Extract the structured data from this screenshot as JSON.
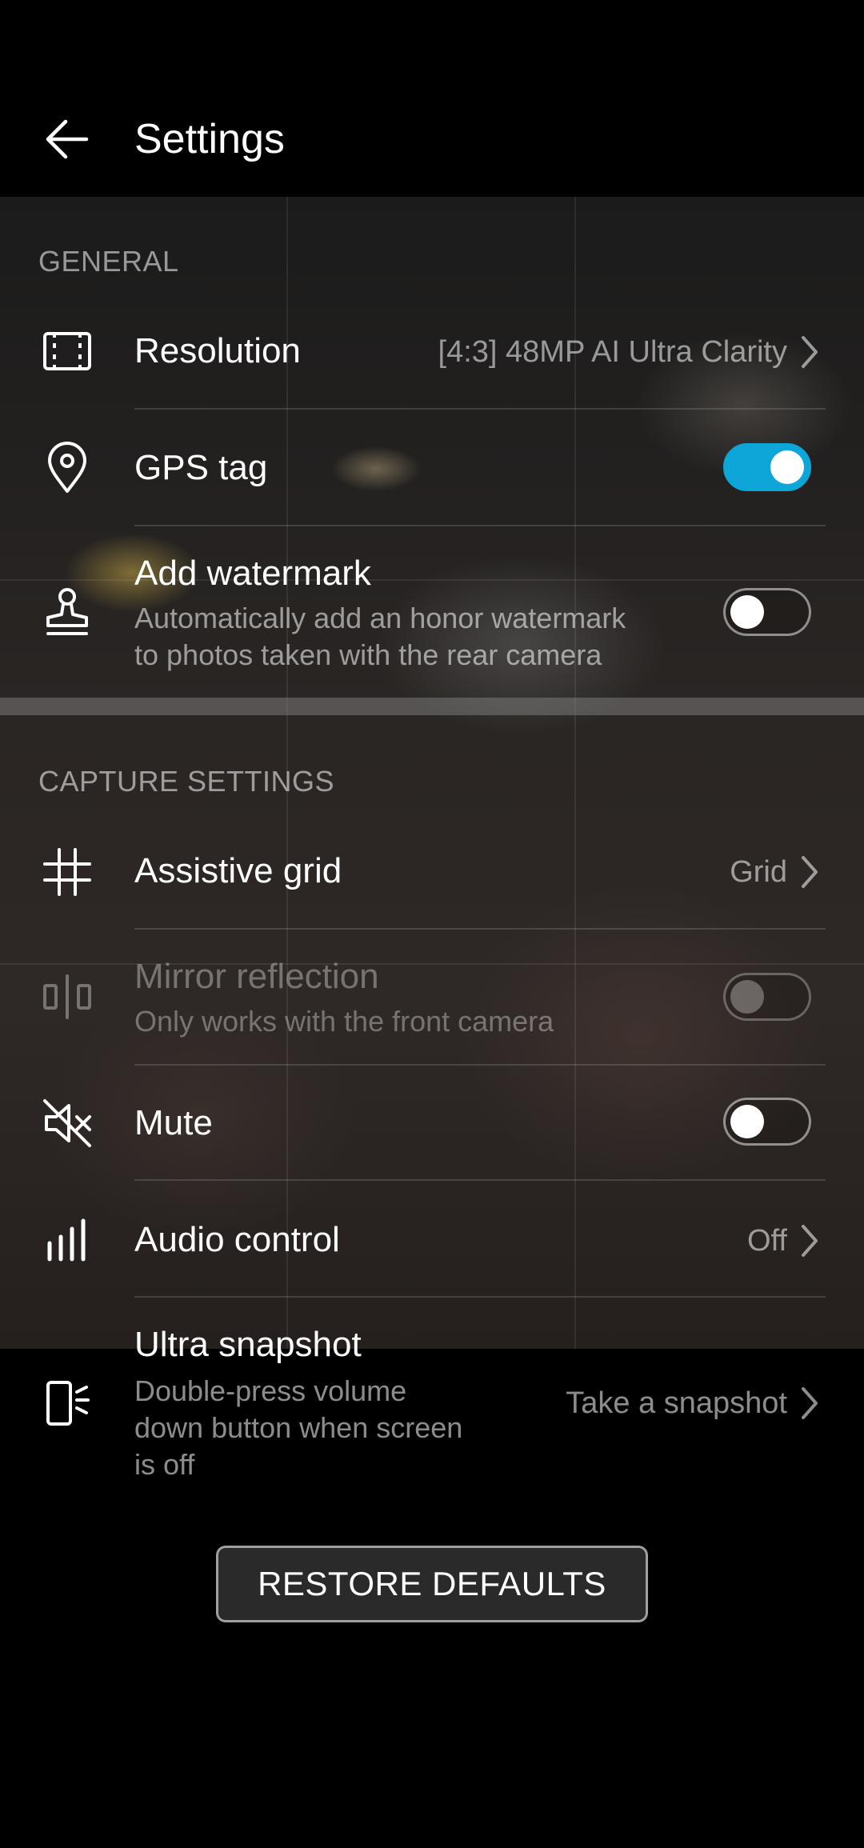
{
  "header": {
    "title": "Settings"
  },
  "general": {
    "label": "GENERAL",
    "resolution": {
      "title": "Resolution",
      "value": "[4:3] 48MP AI Ultra Clarity"
    },
    "gps": {
      "title": "GPS tag",
      "enabled": true
    },
    "watermark": {
      "title": "Add watermark",
      "subtitle_line1": "Automatically add an honor watermark",
      "subtitle_line2": "to photos taken with the rear camera",
      "enabled": false
    }
  },
  "capture": {
    "label": "CAPTURE SETTINGS",
    "grid": {
      "title": "Assistive grid",
      "value": "Grid"
    },
    "mirror": {
      "title": "Mirror reflection",
      "subtitle": "Only works with the front camera",
      "enabled": false,
      "disabled": true
    },
    "mute": {
      "title": "Mute",
      "enabled": false
    },
    "audio": {
      "title": "Audio control",
      "value": "Off"
    },
    "snapshot": {
      "title": "Ultra snapshot",
      "subtitle_line1": "Double-press volume",
      "subtitle_line2": "down button when screen",
      "subtitle_line3": "is off",
      "value": "Take a snapshot"
    }
  },
  "restore_label": "RESTORE DEFAULTS",
  "colors": {
    "accent": "#0ea5d8",
    "background": "#000000"
  },
  "icons": [
    "back-arrow-icon",
    "resolution-icon",
    "location-pin-icon",
    "stamp-icon",
    "grid-icon",
    "mirror-icon",
    "mute-speaker-icon",
    "audio-bars-icon",
    "snapshot-phone-icon",
    "chevron-right-icon"
  ]
}
